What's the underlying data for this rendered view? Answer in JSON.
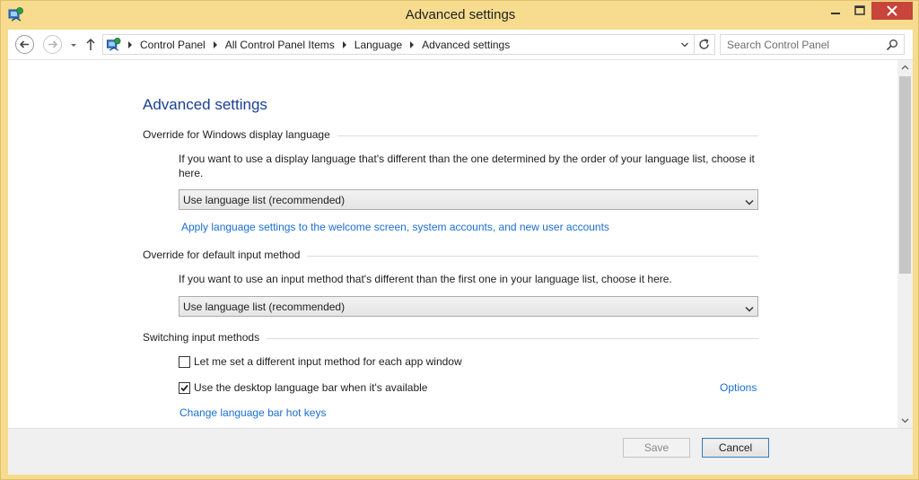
{
  "window": {
    "title": "Advanced settings"
  },
  "address": {
    "crumbs": [
      "Control Panel",
      "All Control Panel Items",
      "Language",
      "Advanced settings"
    ]
  },
  "search": {
    "placeholder": "Search Control Panel"
  },
  "main": {
    "title": "Advanced settings",
    "display_section": {
      "heading": "Override for Windows display language",
      "description": "If you want to use a display language that's different than the one determined by the order of your language list, choose it here.",
      "selected": "Use language list (recommended)",
      "apply_link": "Apply language settings to the welcome screen, system accounts, and new user accounts"
    },
    "input_section": {
      "heading": "Override for default input method",
      "description": "If you want to use an input method that's different than the first one in your language list, choose it here.",
      "selected": "Use language list (recommended)"
    },
    "switching_section": {
      "heading": "Switching input methods",
      "checkbox_per_app": {
        "label": "Let me set a different input method for each app window",
        "checked": false
      },
      "checkbox_langbar": {
        "label": "Use the desktop language bar when it's available",
        "checked": true
      },
      "options_link": "Options",
      "hotkeys_link": "Change language bar hot keys"
    }
  },
  "footer": {
    "save_label": "Save",
    "cancel_label": "Cancel"
  },
  "colors": {
    "frame": "#f7dc8f",
    "close_button": "#c7453b",
    "title_text": "#1a3f96",
    "link": "#1a6ed1"
  },
  "icons": [
    "control-panel-icon",
    "back-arrow-icon",
    "forward-arrow-icon",
    "chevron-down-icon",
    "up-arrow-icon",
    "refresh-icon",
    "search-icon",
    "minimize-icon",
    "maximize-icon",
    "close-icon",
    "checkmark-icon"
  ]
}
